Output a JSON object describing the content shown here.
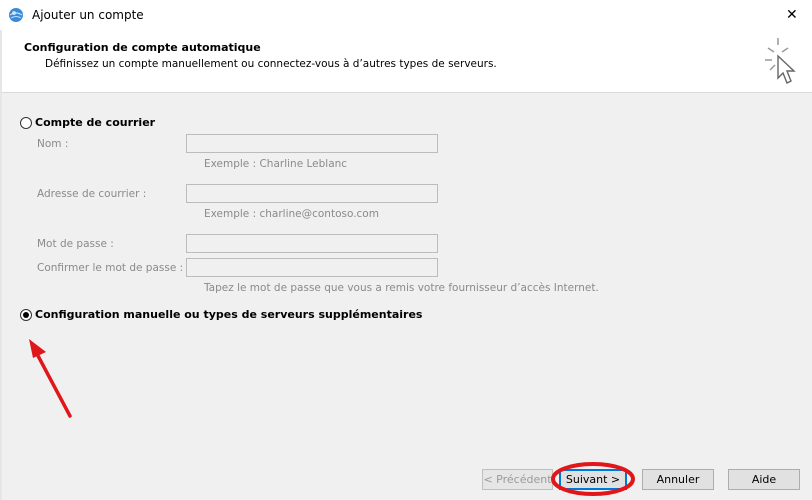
{
  "window": {
    "title": "Ajouter un compte",
    "close_glyph": "✕"
  },
  "header": {
    "title": "Configuration de compte automatique",
    "subtitle": "Définissez un compte manuellement ou connectez-vous à d’autres types de serveurs."
  },
  "options": {
    "email_account": {
      "label": "Compte de courrier",
      "selected": false
    },
    "manual": {
      "label": "Configuration manuelle ou types de serveurs supplémentaires",
      "selected": true
    }
  },
  "form": {
    "name_label": "Nom :",
    "name_value": "",
    "name_hint": "Exemple : Charline Leblanc",
    "email_label": "Adresse de courrier :",
    "email_value": "",
    "email_hint": "Exemple : charline@contoso.com",
    "password_label": "Mot de passe :",
    "password_value": "",
    "confirm_label": "Confirmer le mot de passe :",
    "confirm_value": "",
    "password_hint": "Tapez le mot de passe que vous a remis votre fournisseur d’accès Internet."
  },
  "buttons": {
    "previous": "< Précédent",
    "next": "Suivant >",
    "cancel": "Annuler",
    "help": "Aide"
  },
  "icons": {
    "title": "outlook-globe-icon",
    "wizard": "sparkle-cursor-icon"
  },
  "colors": {
    "annotation": "#e0161b",
    "accent": "#0078d7"
  }
}
